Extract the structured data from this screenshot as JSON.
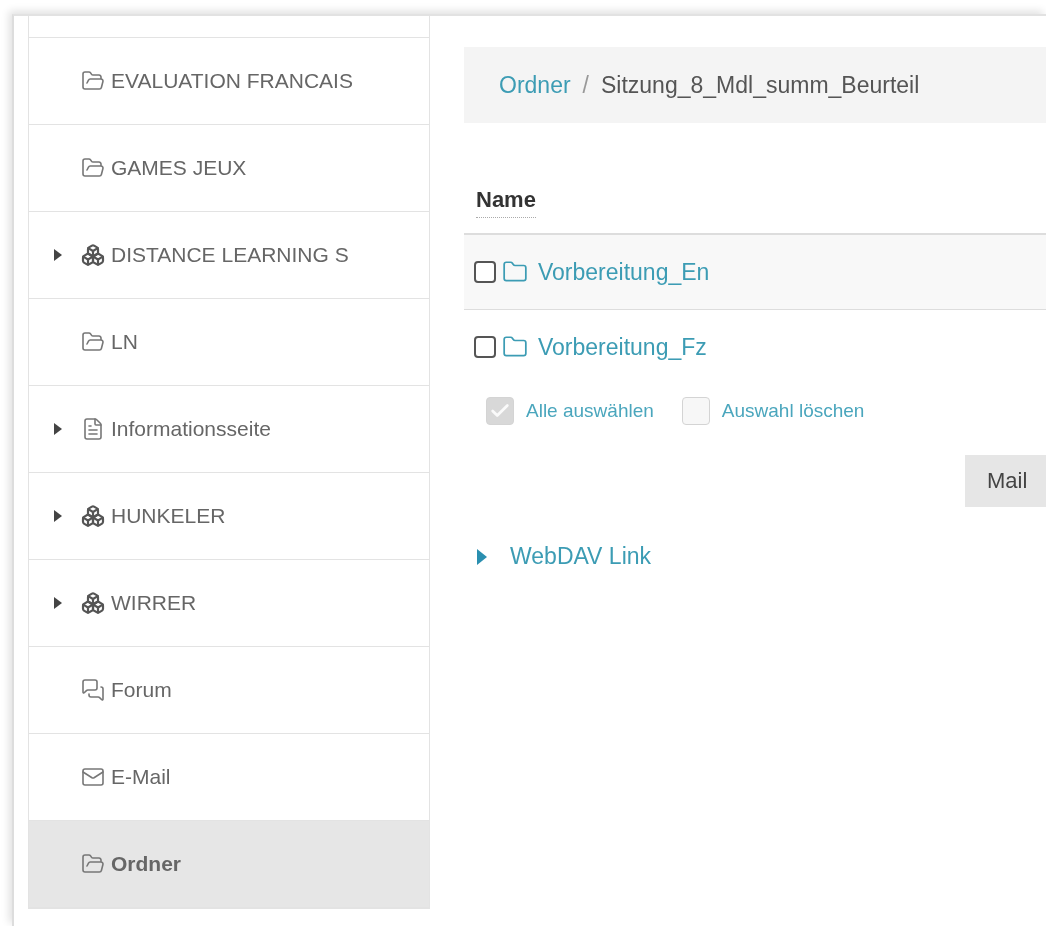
{
  "sidebar": {
    "items": [
      {
        "label": "EVALUATION FRANCAIS",
        "kind": "folder",
        "expandable": false,
        "selected": false
      },
      {
        "label": "GAMES JEUX",
        "kind": "folder",
        "expandable": false,
        "selected": false
      },
      {
        "label": "DISTANCE LEARNING S",
        "kind": "cubes",
        "expandable": true,
        "selected": false
      },
      {
        "label": "LN",
        "kind": "folder",
        "expandable": false,
        "selected": false
      },
      {
        "label": "Informationsseite",
        "kind": "page",
        "expandable": true,
        "selected": false
      },
      {
        "label": "HUNKELER",
        "kind": "cubes",
        "expandable": true,
        "selected": false
      },
      {
        "label": "WIRRER",
        "kind": "cubes",
        "expandable": true,
        "selected": false
      },
      {
        "label": "Forum",
        "kind": "forum",
        "expandable": false,
        "selected": false
      },
      {
        "label": "E-Mail",
        "kind": "mail",
        "expandable": false,
        "selected": false
      },
      {
        "label": "Ordner",
        "kind": "folder",
        "expandable": false,
        "selected": true
      }
    ]
  },
  "breadcrumb": {
    "items": [
      "Ordner",
      "Sitzung_8_Mdl_summ_Beurteil"
    ],
    "separator": "/"
  },
  "table": {
    "columns": [
      "Name"
    ],
    "rows": [
      {
        "name": "Vorbereitung_En",
        "checked": false
      },
      {
        "name": "Vorbereitung_Fz",
        "checked": false
      }
    ]
  },
  "selection": [
    {
      "label": "Alle auswählen",
      "checked": true
    },
    {
      "label": "Auswahl löschen",
      "checked": false
    }
  ],
  "buttons": [
    "Mail"
  ],
  "webdav": {
    "label": "WebDAV Link",
    "expanded": false
  }
}
